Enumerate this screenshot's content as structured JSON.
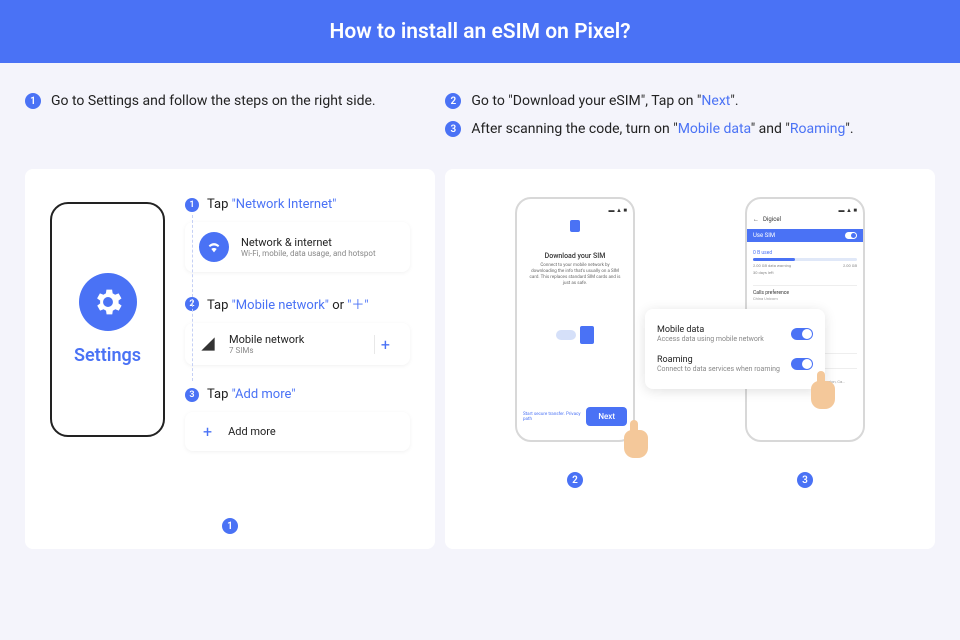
{
  "header": {
    "title": "How to install an eSIM on Pixel?"
  },
  "top_left": {
    "num": "1",
    "text": "Go to Settings and follow the steps on the right side."
  },
  "top_right": [
    {
      "num": "2",
      "pre": "Go to \"Download your eSIM\", Tap on \"",
      "hl": "Next",
      "post": "\"."
    },
    {
      "num": "3",
      "pre": "After scanning the code, turn on \"",
      "hl": "Mobile data",
      "mid": "\" and \"",
      "hl2": "Roaming",
      "post": "\"."
    }
  ],
  "settings_phone": {
    "label": "Settings"
  },
  "steps": [
    {
      "num": "1",
      "pre": "Tap ",
      "hl": "\"Network Internet\""
    },
    {
      "num": "2",
      "pre": "Tap ",
      "hl": "\"Mobile network\"",
      "mid": " or ",
      "hl2": "\"＋\""
    },
    {
      "num": "3",
      "pre": "Tap ",
      "hl": "\"Add more\""
    }
  ],
  "row1": {
    "title": "Network & internet",
    "sub": "Wi-Fi, mobile, data usage, and hotspot"
  },
  "row2": {
    "title": "Mobile network",
    "sub": "7 SIMs",
    "plus": "+"
  },
  "row3": {
    "plus": "+",
    "title": "Add more"
  },
  "card1_badge": "1",
  "phone_dl": {
    "title": "Download your SIM",
    "desc": "Connect to your mobile network by downloading the info that's usually on a SIM card. This replaces standard SIM cards and is just as safe.",
    "link": "Start secure transfer. Privacy path",
    "next": "Next"
  },
  "phone2": {
    "carrier": "Digicel",
    "use_sim": "Use SIM",
    "used": "B used",
    "warn": "2.00 GB data warning",
    "days": "30 days left",
    "limit": "2.00 GB",
    "calls": "Calls preference",
    "calls_sub": "China Unicom",
    "adv": "Data warning & limit",
    "adv2": "Advanced",
    "adv2_sub": "SIM 2, Preferred network type, Settings version, Ca..."
  },
  "popup": {
    "md_label": "Mobile data",
    "md_sub": "Access data using mobile network",
    "rm_label": "Roaming",
    "rm_sub": "Connect to data services when roaming"
  },
  "badge2": "2",
  "badge3": "3"
}
